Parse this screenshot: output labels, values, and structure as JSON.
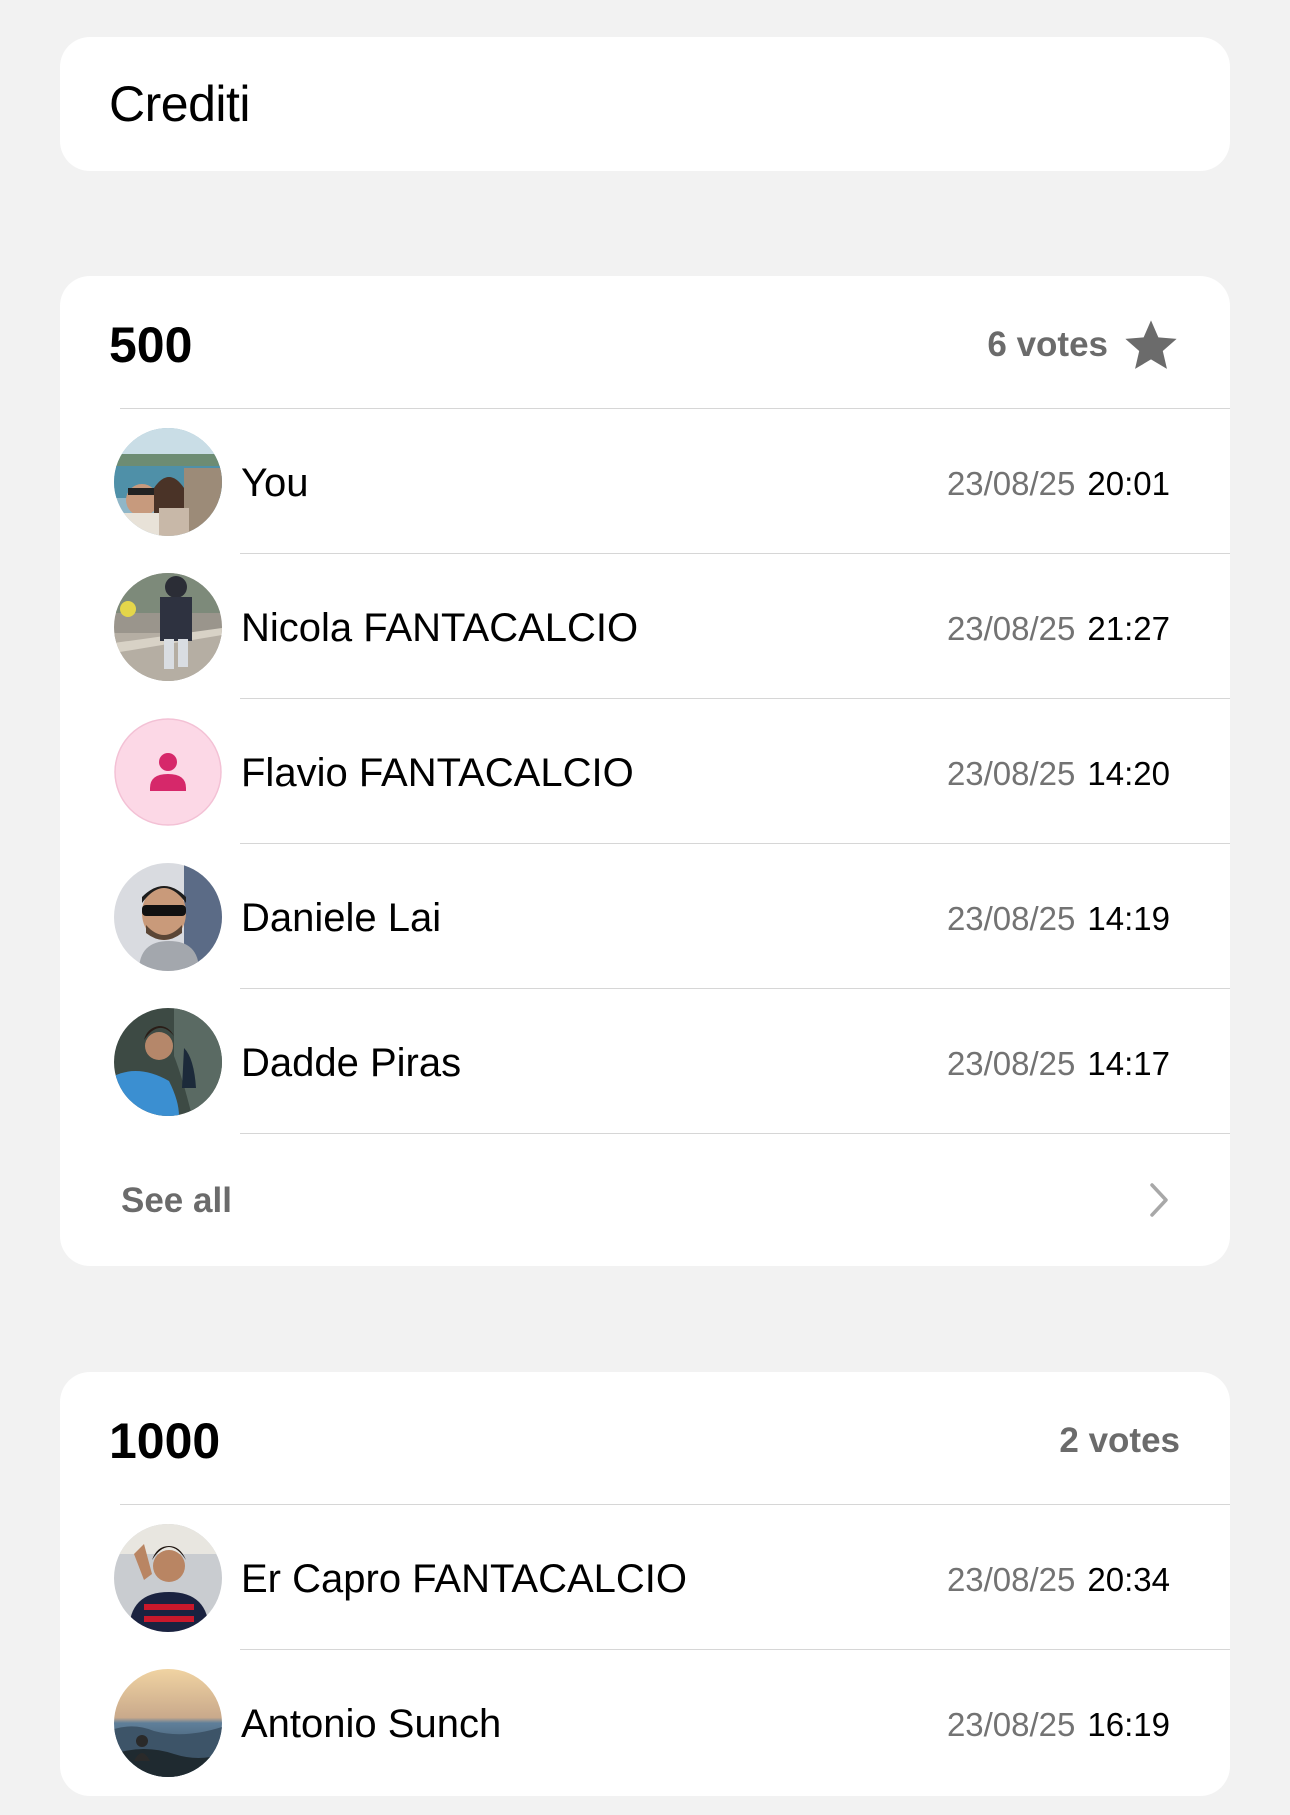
{
  "page": {
    "title": "Crediti"
  },
  "polls": [
    {
      "amount": "500",
      "votes": "6 votes",
      "starred": true,
      "voters": [
        {
          "name": "You",
          "date": "23/08/25",
          "time": "20:01",
          "avatar": "photo-couple-beach"
        },
        {
          "name": "Nicola FANTACALCIO",
          "date": "23/08/25",
          "time": "21:27",
          "avatar": "photo-person-street"
        },
        {
          "name": "Flavio FANTACALCIO",
          "date": "23/08/25",
          "time": "14:20",
          "avatar": "default-person-icon"
        },
        {
          "name": "Daniele Lai",
          "date": "23/08/25",
          "time": "14:19",
          "avatar": "photo-man-sunglasses"
        },
        {
          "name": "Dadde Piras",
          "date": "23/08/25",
          "time": "14:17",
          "avatar": "photo-man-cave"
        }
      ],
      "see_all_label": "See all"
    },
    {
      "amount": "1000",
      "votes": "2 votes",
      "starred": false,
      "voters": [
        {
          "name": "Er Capro FANTACALCIO",
          "date": "23/08/25",
          "time": "20:34",
          "avatar": "photo-man-jersey"
        },
        {
          "name": "Antonio Sunch",
          "date": "23/08/25",
          "time": "16:19",
          "avatar": "photo-seaside-sunset"
        }
      ]
    }
  ],
  "colors": {
    "background": "#f2f2f2",
    "card": "#ffffff",
    "secondary_text": "#737373",
    "divider": "#d6d6d6",
    "default_avatar_bg": "#fcd8e6",
    "default_avatar_icon": "#d6286a"
  }
}
